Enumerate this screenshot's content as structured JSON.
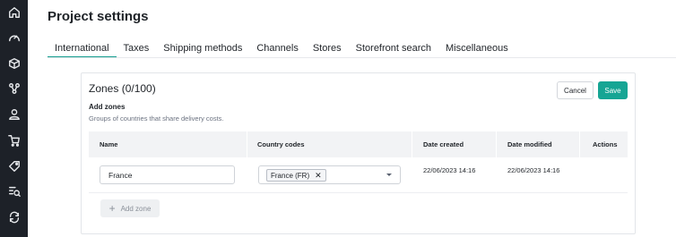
{
  "sidebar": {
    "icons": [
      "home-icon",
      "dashboard-icon",
      "box-icon",
      "network-icon",
      "user-icon",
      "cart-icon",
      "tags-icon",
      "list-search-icon",
      "sync-icon"
    ]
  },
  "page": {
    "title": "Project settings"
  },
  "tabs": [
    {
      "label": "International",
      "active": true
    },
    {
      "label": "Taxes"
    },
    {
      "label": "Shipping methods"
    },
    {
      "label": "Channels"
    },
    {
      "label": "Stores"
    },
    {
      "label": "Storefront search"
    },
    {
      "label": "Miscellaneous"
    }
  ],
  "card": {
    "title": "Zones",
    "count": "(0/100)",
    "add_zones_title": "Add zones",
    "add_zones_desc": "Groups of countries that share delivery costs.",
    "cancel_label": "Cancel",
    "save_label": "Save",
    "save_color": "#16a594"
  },
  "table": {
    "headers": [
      "Name",
      "Country codes",
      "Date created",
      "Date modified",
      "Actions"
    ],
    "rows": [
      {
        "name": "France",
        "country_chip": "France (FR)",
        "chip_remove": "✕",
        "date_created": "22/06/2023 14:16",
        "date_modified": "22/06/2023 14:16"
      }
    ]
  },
  "add_zone_button": {
    "label": "Add zone",
    "icon": "plus-icon"
  },
  "colors": {
    "accent": "#139d8e",
    "sidebar_bg": "#1d2128"
  }
}
